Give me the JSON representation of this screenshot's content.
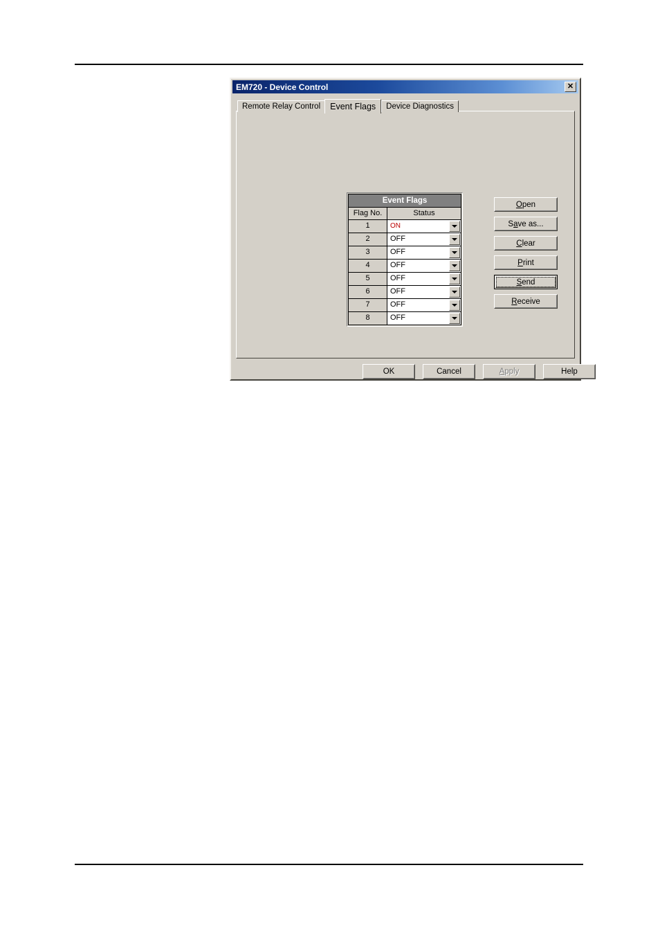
{
  "window": {
    "title": "EM720 - Device Control",
    "close_icon": "close-icon",
    "close_glyph": "✕"
  },
  "tabs": [
    {
      "label": "Remote Relay Control",
      "selected": false
    },
    {
      "label": "Event Flags",
      "selected": true
    },
    {
      "label": "Device Diagnostics",
      "selected": false
    }
  ],
  "flag_table": {
    "title": "Event Flags",
    "columns": [
      "Flag No.",
      "Status"
    ],
    "rows": [
      {
        "num": "1",
        "status": "ON",
        "state": "on"
      },
      {
        "num": "2",
        "status": "OFF",
        "state": "off"
      },
      {
        "num": "3",
        "status": "OFF",
        "state": "off"
      },
      {
        "num": "4",
        "status": "OFF",
        "state": "off"
      },
      {
        "num": "5",
        "status": "OFF",
        "state": "off"
      },
      {
        "num": "6",
        "status": "OFF",
        "state": "off"
      },
      {
        "num": "7",
        "status": "OFF",
        "state": "off"
      },
      {
        "num": "8",
        "status": "OFF",
        "state": "off"
      }
    ],
    "options": [
      "ON",
      "OFF"
    ]
  },
  "side_buttons": [
    {
      "label": "Open",
      "accel": "O",
      "before": "",
      "after": "pen",
      "default": false,
      "disabled": false
    },
    {
      "label": "Save as...",
      "accel": "a",
      "before": "S",
      "after": "ve as...",
      "default": false,
      "disabled": false
    },
    {
      "label": "Clear",
      "accel": "C",
      "before": "",
      "after": "lear",
      "default": false,
      "disabled": false
    },
    {
      "label": "Print",
      "accel": "P",
      "before": "",
      "after": "rint",
      "default": false,
      "disabled": false
    },
    {
      "label": "Send",
      "accel": "S",
      "before": "",
      "after": "end",
      "default": true,
      "disabled": false
    },
    {
      "label": "Receive",
      "accel": "R",
      "before": "",
      "after": "eceive",
      "default": false,
      "disabled": false
    }
  ],
  "bottom_buttons": [
    {
      "label": "OK",
      "accel": "",
      "before": "OK",
      "after": "",
      "disabled": false
    },
    {
      "label": "Cancel",
      "accel": "",
      "before": "Cancel",
      "after": "",
      "disabled": false
    },
    {
      "label": "Apply",
      "accel": "A",
      "before": "",
      "after": "pply",
      "disabled": true
    },
    {
      "label": "Help",
      "accel": "",
      "before": "Help",
      "after": "",
      "disabled": false
    }
  ],
  "colors": {
    "dialog_face": "#d4d0c8",
    "title_start": "#0a246a",
    "title_end": "#a6caf0",
    "table_header": "#808080",
    "status_on": "#bb0000",
    "status_off": "#000000"
  }
}
